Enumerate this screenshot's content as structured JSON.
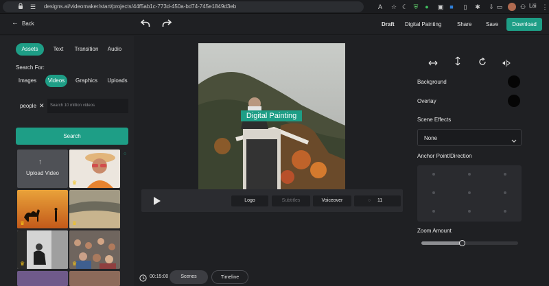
{
  "browser": {
    "url": "designs.ai/videomaker/start/projects/44f5ab1c-773d-450a-bd74-745e1849d3eb",
    "profile_text": "Läi"
  },
  "header": {
    "back_label": "Back",
    "draft_label": "Draft",
    "project_name": "Digital Painting",
    "share_label": "Share",
    "save_label": "Save",
    "download_label": "Download"
  },
  "left_panel": {
    "tabs": [
      {
        "label": "Assets",
        "active": true
      },
      {
        "label": "Text",
        "active": false
      },
      {
        "label": "Transition",
        "active": false
      },
      {
        "label": "Audio",
        "active": false
      }
    ],
    "search_for_label": "Search For:",
    "filters": [
      {
        "label": "Images",
        "active": false
      },
      {
        "label": "Videos",
        "active": true
      },
      {
        "label": "Graphics",
        "active": false
      },
      {
        "label": "Uploads",
        "active": false
      }
    ],
    "search_tag": "people",
    "search_placeholder": "Search 10 million videos",
    "search_button_label": "Search",
    "upload_label": "Upload Video"
  },
  "canvas": {
    "caption_text": "Digital Painting",
    "controls": [
      {
        "label": "Logo"
      },
      {
        "label": "Subtitles"
      },
      {
        "label": "Voiceover"
      },
      {
        "label": "11"
      }
    ]
  },
  "bottom": {
    "duration": "00:15:00",
    "scenes_label": "Scenes",
    "timeline_label": "Timeline"
  },
  "right_panel": {
    "background_label": "Background",
    "overlay_label": "Overlay",
    "scene_effects_label": "Scene Effects",
    "scene_effect_value": "None",
    "anchor_label": "Anchor Point/Direction",
    "zoom_label": "Zoom Amount",
    "zoom_value": 0.42
  },
  "colors": {
    "accent": "#1e9e86",
    "background": "#1f2023"
  }
}
